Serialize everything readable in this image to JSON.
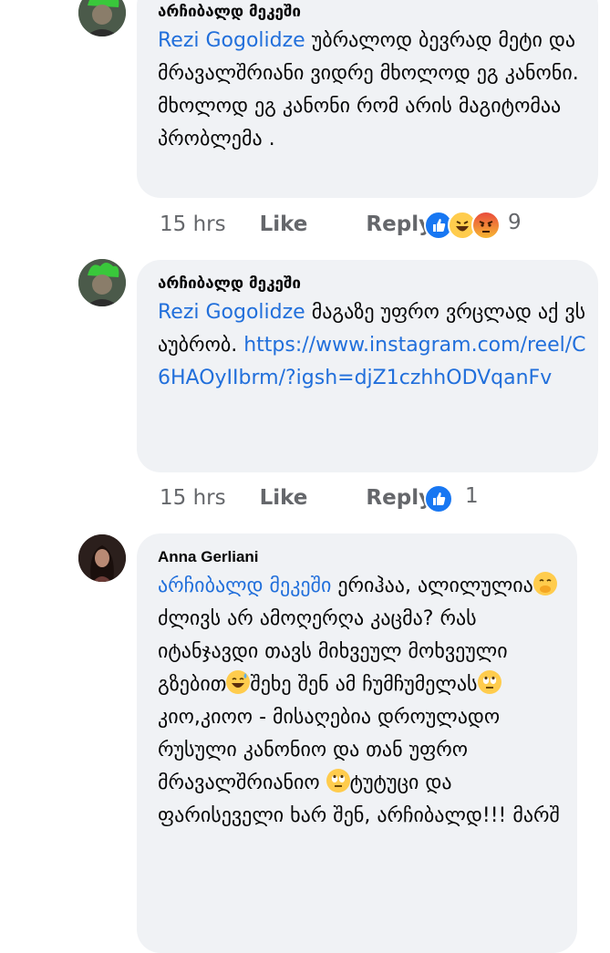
{
  "comments": [
    {
      "author": "არჩიბალდ მეკეში",
      "mention": "Rezi Gogolidze",
      "text": " უბრალოდ ბევრად მეტი და მრავალშრიანი ვიდრე მხოლოდ ეგ კანონი. მხოლოდ ეგ კანონი რომ არის მაგიტომაა პრობლემა .",
      "time": "15 hrs",
      "like_label": "Like",
      "reply_label": "Reply",
      "reactions": [
        "like-icon",
        "haha-icon",
        "angry-icon"
      ],
      "reaction_count": "9"
    },
    {
      "author": "არჩიბალდ მეკეში",
      "mention": "Rezi Gogolidze",
      "text": " მაგაზე უფრო ვრცლად აქ ვსაუბრობ. ",
      "link": "https://www.instagram.com/reel/C6HAOyIIbrm/?igsh=djZ1czhhODVqanFv",
      "time": "15 hrs",
      "like_label": "Like",
      "reply_label": "Reply",
      "reactions": [
        "like-icon"
      ],
      "reaction_count": "1"
    },
    {
      "author": "Anna Gerliani",
      "mention": "არჩიბალდ მეკეში",
      "text_parts": [
        " ერიჰაა, ალილულია",
        "ძლივს არ ამოღერღა კაცმა? რას იტანჯავდი თავს მიხვეულ მოხვეული გზებით",
        "შეხე შენ ამ ჩუმჩუმელას",
        "კიო,კიოო - მისაღებია დროულადო რუსული კანონიო და თან უფრო მრავალშრიანიო ",
        "ტუტუცი  და ფარისეველი ხარ შენ, არჩიბალდ!!! მარშ"
      ],
      "emojis": [
        "face-with-hand-over-mouth-emoji",
        "grinning-sweat-emoji",
        "rolling-eyes-emoji",
        "rolling-eyes-emoji"
      ]
    }
  ]
}
